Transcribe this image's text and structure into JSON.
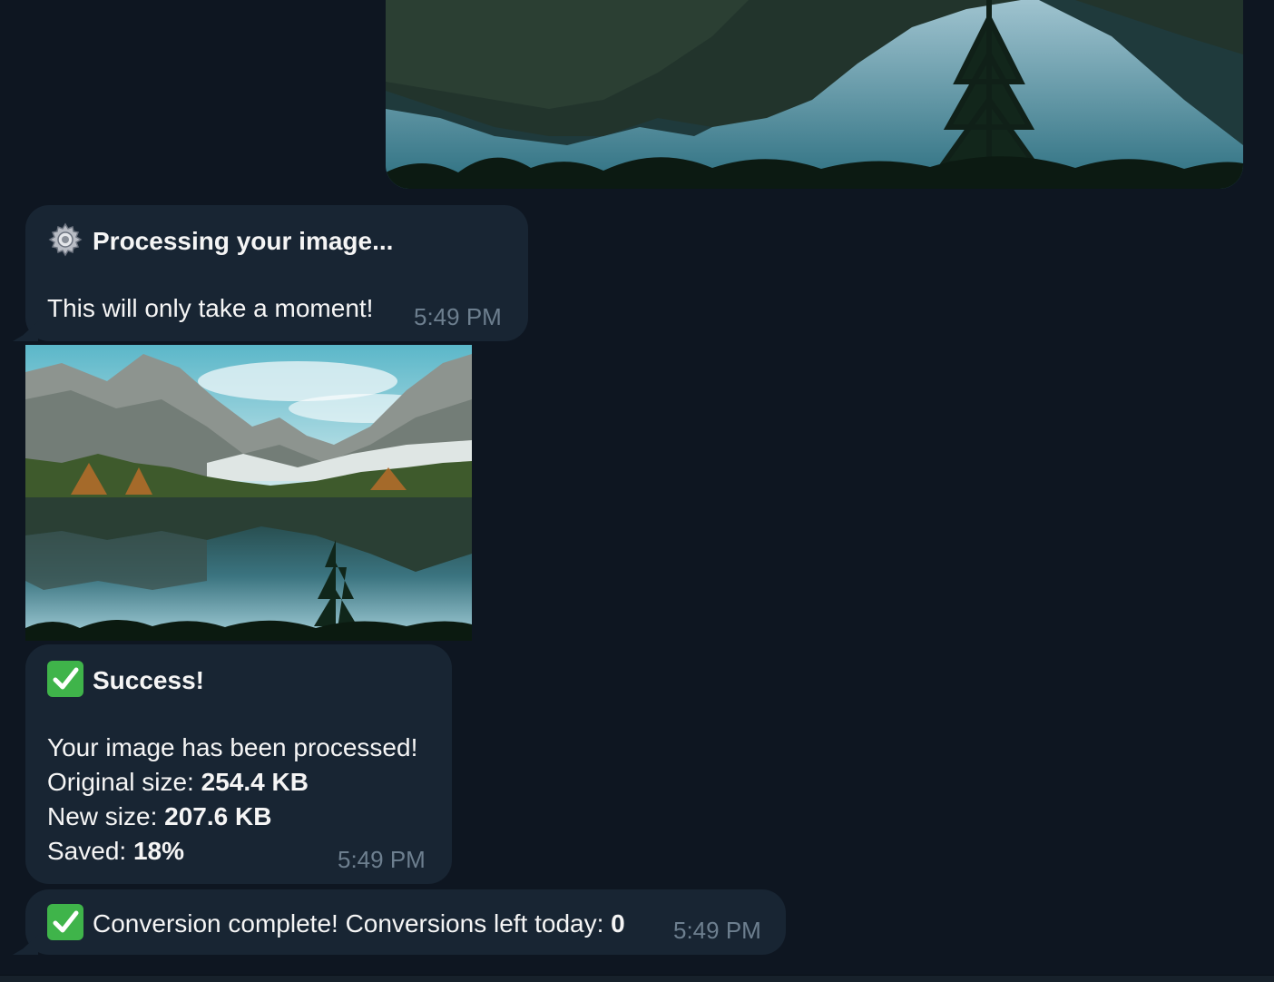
{
  "messages": {
    "processing": {
      "icon": "gear-icon",
      "title": "Processing your image...",
      "body": "This will only take a moment!",
      "time": "5:49 PM"
    },
    "success": {
      "icon": "check-mark-icon",
      "title": "Success!",
      "line1": "Your image has been processed!",
      "original_label": "Original size: ",
      "original_value": "254.4 KB",
      "new_label": "New size: ",
      "new_value": "207.6 KB",
      "saved_label": "Saved: ",
      "saved_value": "18%",
      "time": "5:49 PM"
    },
    "complete": {
      "icon": "check-mark-icon",
      "text": "Conversion complete! Conversions left today: ",
      "count": "0",
      "time": "5:49 PM"
    }
  },
  "colors": {
    "background": "#0e1621",
    "bubble": "#182533",
    "timestamp": "#6d7f8f",
    "check_green": "#3fb44a"
  }
}
